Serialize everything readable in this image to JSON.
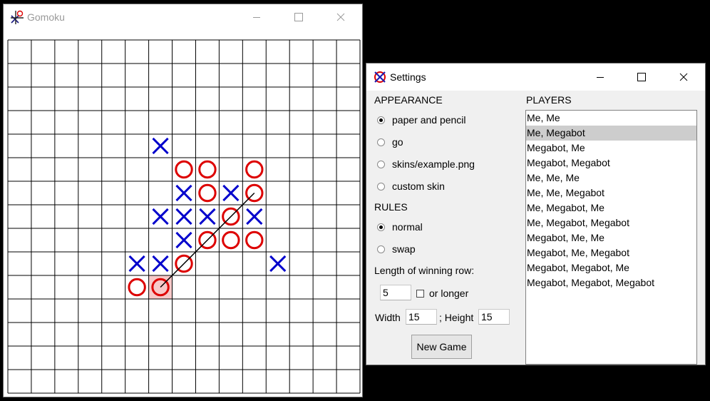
{
  "gomoku_window": {
    "title": "Gomoku",
    "board": {
      "columns": 15,
      "rows": 15,
      "line_color": "#000000",
      "x_color": "#0000cc",
      "o_color": "#dd0000",
      "crosses": [
        [
          6,
          4
        ],
        [
          7,
          6
        ],
        [
          9,
          6
        ],
        [
          6,
          7
        ],
        [
          7,
          7
        ],
        [
          8,
          7
        ],
        [
          10,
          7
        ],
        [
          7,
          8
        ],
        [
          5,
          9
        ],
        [
          6,
          9
        ],
        [
          11,
          9
        ]
      ],
      "noughts": [
        [
          7,
          5
        ],
        [
          8,
          5
        ],
        [
          10,
          5
        ],
        [
          8,
          6
        ],
        [
          10,
          6
        ],
        [
          9,
          7
        ],
        [
          8,
          8
        ],
        [
          9,
          8
        ],
        [
          10,
          8
        ],
        [
          7,
          9
        ],
        [
          5,
          10
        ],
        [
          6,
          10
        ]
      ],
      "last_move_highlight": [
        6,
        10
      ],
      "winning_line": {
        "from": [
          10,
          6
        ],
        "to": [
          6,
          10
        ]
      }
    }
  },
  "settings_window": {
    "title": "Settings",
    "appearance": {
      "heading": "APPEARANCE",
      "options": [
        {
          "label": "paper and pencil",
          "selected": true
        },
        {
          "label": "go",
          "selected": false
        },
        {
          "label": "skins/example.png",
          "selected": false
        },
        {
          "label": "custom skin",
          "selected": false
        }
      ]
    },
    "rules": {
      "heading": "RULES",
      "options": [
        {
          "label": "normal",
          "selected": true
        },
        {
          "label": "swap",
          "selected": false
        }
      ]
    },
    "winning_row": {
      "label": "Length of winning row:",
      "value": "5",
      "or_longer_label": "or longer",
      "or_longer_checked": false
    },
    "size": {
      "width_label": "Width",
      "width_value": "15",
      "height_label": "; Height",
      "height_value": "15"
    },
    "new_game_label": "New Game",
    "players": {
      "heading": "PLAYERS",
      "selected_index": 1,
      "items": [
        "Me, Me",
        "Me, Megabot",
        "Megabot, Me",
        "Megabot, Megabot",
        "Me, Me, Me",
        "Me, Me, Megabot",
        "Me, Megabot, Me",
        "Me, Megabot, Megabot",
        "Megabot, Me, Me",
        "Megabot, Me, Megabot",
        "Megabot, Megabot, Me",
        "Megabot, Megabot, Megabot"
      ]
    }
  }
}
